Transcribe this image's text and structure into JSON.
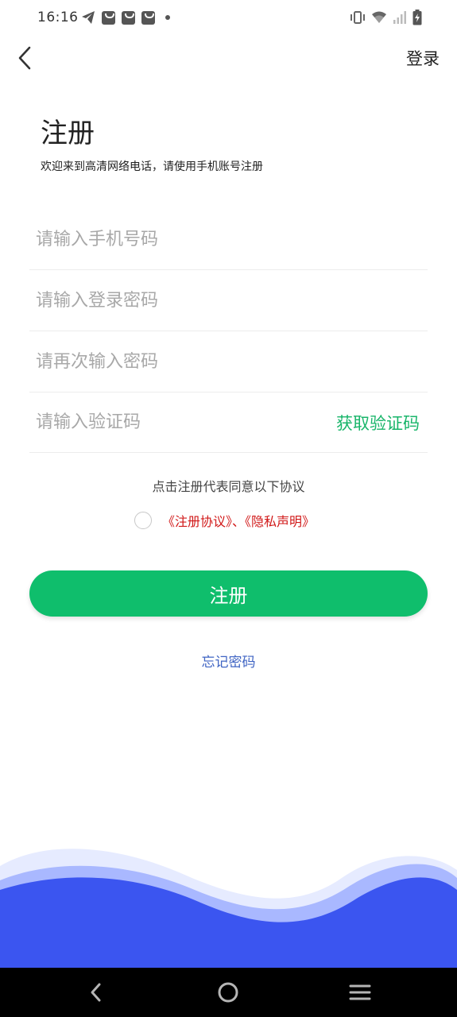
{
  "status_bar": {
    "time": "16:16",
    "left_icons": [
      "telegram-icon",
      "shopping-bag-icon",
      "shopping-bag-icon",
      "shopping-bag-icon",
      "notification-dot-icon"
    ],
    "right_icons": [
      "vibrate-icon",
      "wifi-icon",
      "cellular-signal-icon",
      "battery-charging-icon"
    ]
  },
  "header": {
    "back_icon": "chevron-left-icon",
    "login_label": "登录"
  },
  "page": {
    "title": "注册",
    "subtitle": "欢迎来到高清网络电话，请使用手机账号注册"
  },
  "form": {
    "phone_placeholder": "请输入手机号码",
    "password_placeholder": "请输入登录密码",
    "confirm_password_placeholder": "请再次输入密码",
    "code_placeholder": "请输入验证码",
    "get_code_label": "获取验证码"
  },
  "agreement": {
    "text": "点击注册代表同意以下协议",
    "links": "《注册协议》、《隐私声明》",
    "checked": false
  },
  "actions": {
    "register_label": "注册",
    "forgot_label": "忘记密码"
  },
  "nav_bar": {
    "icons": [
      "back-icon",
      "home-icon",
      "menu-icon"
    ]
  },
  "colors": {
    "accent_green": "#0fbe6c",
    "link_red": "#d11818",
    "link_blue": "#3f64c3",
    "wave_blue": "#3b55f0"
  }
}
